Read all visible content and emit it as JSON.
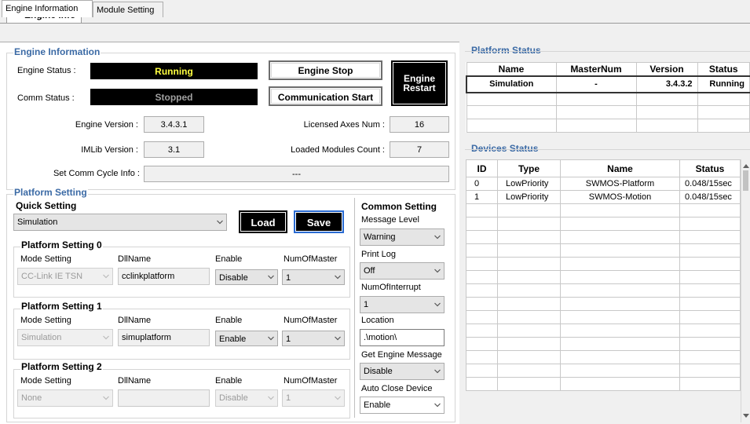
{
  "window_tab": "Engine Info",
  "tabs": [
    "Engine Information",
    "Module Setting"
  ],
  "engine_info": {
    "legend": "Engine Information",
    "engine_status_label": "Engine Status :",
    "engine_status_value": "Running",
    "comm_status_label": "Comm Status :",
    "comm_status_value": "Stopped",
    "engine_stop_button": "Engine Stop",
    "comm_start_button": "Communication Start",
    "engine_restart_line1": "Engine",
    "engine_restart_line2": "Restart",
    "engine_version_label": "Engine Version :",
    "engine_version_value": "3.4.3.1",
    "imlib_version_label": "IMLib Version :",
    "imlib_version_value": "3.1",
    "licensed_axes_label": "Licensed Axes Num :",
    "licensed_axes_value": "16",
    "loaded_modules_label": "Loaded Modules Count :",
    "loaded_modules_value": "7",
    "comm_cycle_label": "Set Comm Cycle Info :",
    "comm_cycle_value": "---"
  },
  "platform_setting": {
    "legend": "Platform Setting",
    "quick_setting_label": "Quick Setting",
    "quick_setting_value": "Simulation",
    "load_button": "Load",
    "save_button": "Save",
    "column_headers": {
      "mode": "Mode Setting",
      "dll": "DllName",
      "enable": "Enable",
      "num": "NumOfMaster"
    },
    "platforms": [
      {
        "title": "Platform Setting 0",
        "mode": "CC-Link IE TSN",
        "dll": "cclinkplatform",
        "enable": "Disable",
        "num": "1"
      },
      {
        "title": "Platform Setting 1",
        "mode": "Simulation",
        "dll": "simuplatform",
        "enable": "Enable",
        "num": "1"
      },
      {
        "title": "Platform Setting 2",
        "mode": "None",
        "dll": "",
        "enable": "Disable",
        "num": "1"
      }
    ]
  },
  "common_setting": {
    "title": "Common Setting",
    "message_level_label": "Message Level",
    "message_level_value": "Warning",
    "print_log_label": "Print Log",
    "print_log_value": "Off",
    "num_interrupt_label": "NumOfInterrupt",
    "num_interrupt_value": "1",
    "location_label": "Location",
    "location_value": ".\\motion\\",
    "get_engine_msg_label": "Get Engine Message",
    "get_engine_msg_value": "Disable",
    "auto_close_label": "Auto Close Device",
    "auto_close_value": "Enable"
  },
  "platform_status": {
    "legend": "Platform Status",
    "headers": [
      "Name",
      "MasterNum",
      "Version",
      "Status"
    ],
    "rows": [
      [
        "Simulation",
        "-",
        "3.4.3.2",
        "Running"
      ]
    ]
  },
  "devices_status": {
    "legend": "Devices Status",
    "headers": [
      "ID",
      "Type",
      "Name",
      "Status"
    ],
    "rows": [
      [
        "0",
        "LowPriority",
        "SWMOS-Platform",
        "0.048/15sec"
      ],
      [
        "1",
        "LowPriority",
        "SWMOS-Motion",
        "0.048/15sec"
      ]
    ]
  },
  "colors": {
    "running": "#ffff40",
    "stopped": "#a0a0a0",
    "legend_blue": "#3b6aa5",
    "save_border": "#2a6bd2"
  },
  "icons": {
    "dropdown": "chevron-down-icon",
    "scroll_up": "scroll-up-arrow-icon",
    "scroll_down": "scroll-down-arrow-icon"
  }
}
